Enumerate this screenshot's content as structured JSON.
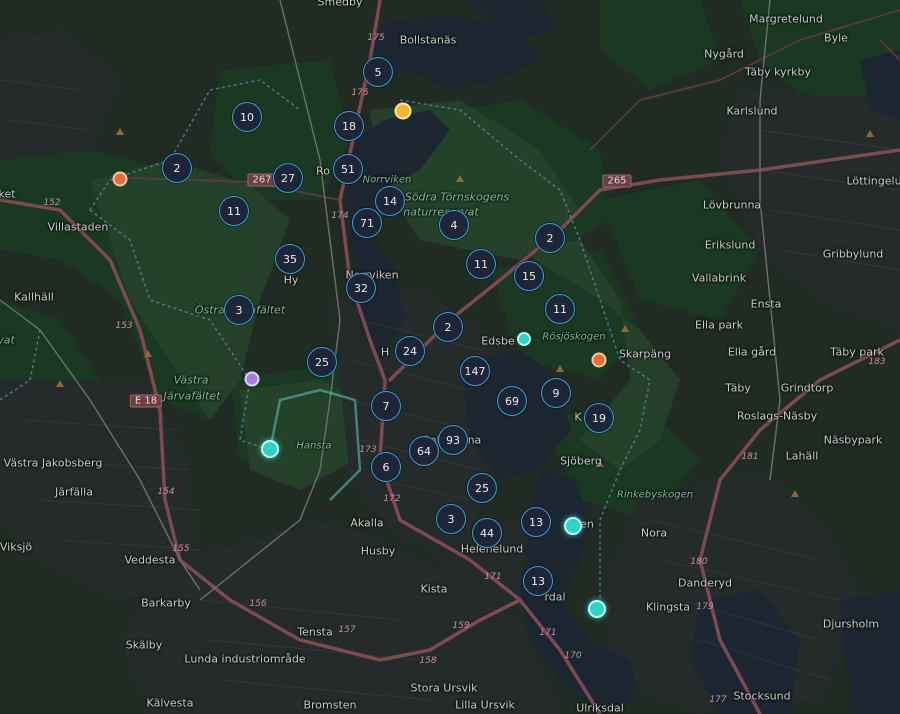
{
  "map": {
    "places": [
      {
        "id": "smedby",
        "label": "Smedby",
        "cls": ""
      },
      {
        "id": "bollstanas",
        "label": "Bollstanäs",
        "cls": ""
      },
      {
        "id": "margretelund",
        "label": "Margretelund",
        "cls": ""
      },
      {
        "id": "byle",
        "label": "Byle",
        "cls": ""
      },
      {
        "id": "nygard",
        "label": "Nygård",
        "cls": ""
      },
      {
        "id": "taby-kyrkby",
        "label": "Täby kyrkby",
        "cls": ""
      },
      {
        "id": "karlslund",
        "label": "Karlslund",
        "cls": ""
      },
      {
        "id": "lottingelund",
        "label": "Löttingelu",
        "cls": ""
      },
      {
        "id": "lovbrunna",
        "label": "Lövbrunna",
        "cls": ""
      },
      {
        "id": "erikslund",
        "label": "Erikslund",
        "cls": ""
      },
      {
        "id": "gribbylund",
        "label": "Gribbylund",
        "cls": ""
      },
      {
        "id": "vallabrink",
        "label": "Vallabrink",
        "cls": ""
      },
      {
        "id": "ensta",
        "label": "Ensta",
        "cls": ""
      },
      {
        "id": "ella-park",
        "label": "Ella park",
        "cls": ""
      },
      {
        "id": "ella-gard",
        "label": "Ella gård",
        "cls": ""
      },
      {
        "id": "taby-park",
        "label": "Täby park",
        "cls": ""
      },
      {
        "id": "skarpang",
        "label": "Skarpäng",
        "cls": ""
      },
      {
        "id": "grindtorp",
        "label": "Grindtorp",
        "cls": ""
      },
      {
        "id": "taby",
        "label": "Täby",
        "cls": ""
      },
      {
        "id": "roslags-nasby",
        "label": "Roslags-Näsby",
        "cls": ""
      },
      {
        "id": "nasbypark",
        "label": "Näsbypark",
        "cls": ""
      },
      {
        "id": "lahall",
        "label": "Lahäll",
        "cls": ""
      },
      {
        "id": "nora",
        "label": "Nora",
        "cls": ""
      },
      {
        "id": "danderyd",
        "label": "Danderyd",
        "cls": ""
      },
      {
        "id": "klingsta",
        "label": "Klingsta",
        "cls": ""
      },
      {
        "id": "djursholm",
        "label": "Djursholm",
        "cls": ""
      },
      {
        "id": "stocksund",
        "label": "Stocksund",
        "cls": ""
      },
      {
        "id": "sjoberg",
        "label": "Sjöberg",
        "cls": ""
      },
      {
        "id": "edsberg",
        "label": "Edsbe",
        "cls": ""
      },
      {
        "id": "norrviken",
        "label": "Norrviken",
        "cls": ""
      },
      {
        "id": "norrviken-lake",
        "label": "Norrviken",
        "cls": "green"
      },
      {
        "id": "sodra-tornskogens",
        "label": "Södra Törnskogens",
        "cls": "park"
      },
      {
        "id": "naturreservat",
        "label": "naturreservat",
        "cls": "park"
      },
      {
        "id": "rosjoskogen",
        "label": "Rösjöskogen",
        "cls": "green"
      },
      {
        "id": "rinkebyskogen",
        "label": "Rinkebyskogen",
        "cls": "green"
      },
      {
        "id": "hansta",
        "label": "Hansta",
        "cls": "green"
      },
      {
        "id": "ostra-jarvafaltet",
        "label": "Östra Järvafältet",
        "cls": "park"
      },
      {
        "id": "vastra",
        "label": "Västra",
        "cls": "park"
      },
      {
        "id": "jarvafaltet",
        "label": "Järvafältet",
        "cls": "park"
      },
      {
        "id": "villastaden",
        "label": "Villastaden",
        "cls": ""
      },
      {
        "id": "kallhall",
        "label": "Kallhäll",
        "cls": ""
      },
      {
        "id": "vastra-jakobsberg",
        "label": "Västra Jakobsberg",
        "cls": ""
      },
      {
        "id": "jarfalla",
        "label": "Järfälla",
        "cls": ""
      },
      {
        "id": "viksjo",
        "label": "Viksjö",
        "cls": ""
      },
      {
        "id": "veddesta",
        "label": "Veddesta",
        "cls": ""
      },
      {
        "id": "barkarby",
        "label": "Barkarby",
        "cls": ""
      },
      {
        "id": "skalby",
        "label": "Skälby",
        "cls": ""
      },
      {
        "id": "lunda",
        "label": "Lunda industriområde",
        "cls": ""
      },
      {
        "id": "kalvesta",
        "label": "Kälvesta",
        "cls": ""
      },
      {
        "id": "tensta",
        "label": "Tensta",
        "cls": ""
      },
      {
        "id": "bromsten",
        "label": "Bromsten",
        "cls": ""
      },
      {
        "id": "akalla",
        "label": "Akalla",
        "cls": ""
      },
      {
        "id": "husby",
        "label": "Husby",
        "cls": ""
      },
      {
        "id": "kista",
        "label": "Kista",
        "cls": ""
      },
      {
        "id": "helenelund",
        "label": "Helenelund",
        "cls": ""
      },
      {
        "id": "sollentuna",
        "label": "Sollentuna",
        "cls": ""
      },
      {
        "id": "sundbyberg-edge",
        "label": "Stora Ursvik",
        "cls": ""
      },
      {
        "id": "lilla-ursvik",
        "label": "Lilla Ursvik",
        "cls": ""
      },
      {
        "id": "ulriksdal",
        "label": "Ulriksdal",
        "cls": ""
      },
      {
        "id": "hagalund",
        "label": "H",
        "cls": ""
      },
      {
        "id": "ro",
        "label": "Ro",
        "cls": ""
      },
      {
        "id": "hy",
        "label": "Hy",
        "cls": ""
      },
      {
        "id": "ket",
        "label": "ket",
        "cls": ""
      },
      {
        "id": "kt",
        "label": "K",
        "cls": ""
      },
      {
        "id": "rinkeby-ered",
        "label": "rdal",
        "cls": ""
      },
      {
        "id": "vat",
        "label": "vat",
        "cls": "park"
      },
      {
        "id": "en",
        "label": "en",
        "cls": ""
      }
    ],
    "road_shields": [
      {
        "id": "e18",
        "label": "E 18"
      },
      {
        "id": "r265",
        "label": "265"
      },
      {
        "id": "r267",
        "label": "267"
      }
    ],
    "road_numbers": [
      "175",
      "175",
      "152",
      "153",
      "174",
      "173",
      "172",
      "154",
      "155",
      "156",
      "157",
      "158",
      "159",
      "171",
      "171",
      "170",
      "180",
      "179",
      "181",
      "183",
      "177"
    ],
    "clusters": [
      {
        "id": "c5",
        "count": "5"
      },
      {
        "id": "c10",
        "count": "10"
      },
      {
        "id": "c18",
        "count": "18"
      },
      {
        "id": "c2a",
        "count": "2"
      },
      {
        "id": "c27",
        "count": "27"
      },
      {
        "id": "c51",
        "count": "51"
      },
      {
        "id": "c11a",
        "count": "11"
      },
      {
        "id": "c14",
        "count": "14"
      },
      {
        "id": "c71",
        "count": "71"
      },
      {
        "id": "c4",
        "count": "4"
      },
      {
        "id": "c2b",
        "count": "2"
      },
      {
        "id": "c35",
        "count": "35"
      },
      {
        "id": "c11b",
        "count": "11"
      },
      {
        "id": "c15",
        "count": "15"
      },
      {
        "id": "c32",
        "count": "32"
      },
      {
        "id": "c3a",
        "count": "3"
      },
      {
        "id": "c11c",
        "count": "11"
      },
      {
        "id": "c2c",
        "count": "2"
      },
      {
        "id": "c24",
        "count": "24"
      },
      {
        "id": "c25a",
        "count": "25"
      },
      {
        "id": "c147",
        "count": "147"
      },
      {
        "id": "c69",
        "count": "69"
      },
      {
        "id": "c9",
        "count": "9"
      },
      {
        "id": "c7",
        "count": "7"
      },
      {
        "id": "c19",
        "count": "19"
      },
      {
        "id": "c93",
        "count": "93"
      },
      {
        "id": "c64",
        "count": "64"
      },
      {
        "id": "c6",
        "count": "6"
      },
      {
        "id": "c25b",
        "count": "25"
      },
      {
        "id": "c3b",
        "count": "3"
      },
      {
        "id": "c44",
        "count": "44"
      },
      {
        "id": "c13a",
        "count": "13"
      },
      {
        "id": "c13b",
        "count": "13"
      }
    ],
    "markers": [
      {
        "id": "m-yellow",
        "color": "#f2b831"
      },
      {
        "id": "m-orange-w",
        "color": "#e07038"
      },
      {
        "id": "m-orange-e",
        "color": "#e07038"
      },
      {
        "id": "m-purple",
        "color": "#a57ee0"
      },
      {
        "id": "m-teal-1",
        "color": "#2fd3c6"
      },
      {
        "id": "m-teal-2",
        "color": "#2fd3c6"
      },
      {
        "id": "m-teal-3",
        "color": "#2fd3c6"
      },
      {
        "id": "m-teal-4",
        "color": "#2fd3c6"
      }
    ]
  }
}
